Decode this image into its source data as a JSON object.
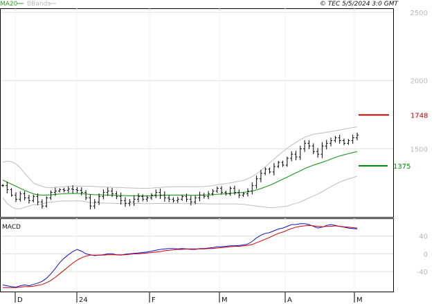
{
  "header": {
    "legend_ma": "MA20",
    "legend_bb": "BBands",
    "copyright": "© TEC 5/5/2024 3:0 GMT"
  },
  "colors": {
    "ma": "#2ca02c",
    "bbands": "#bdbdbd",
    "resistance": "#c00000",
    "support": "#009000",
    "macd": "#1010d0",
    "signal": "#cc0000",
    "bars": "#000000",
    "grid": "#e0e0e0"
  },
  "chart_data": [
    {
      "type": "ohlc",
      "x_axis": {
        "ticks": [
          "D",
          "24",
          "F",
          "M",
          "A",
          "M"
        ]
      },
      "y_axis": {
        "ticks": [
          "2500",
          "2000",
          "1500"
        ],
        "range": [
          1000,
          2530
        ]
      },
      "levels": [
        {
          "label": "1748",
          "value": 1748,
          "color": "#c00000"
        },
        {
          "label": "1375",
          "value": 1375,
          "color": "#009000"
        }
      ],
      "series": {
        "close": [
          1230,
          1200,
          1160,
          1130,
          1170,
          1140,
          1120,
          1150,
          1110,
          1080,
          1140,
          1180,
          1190,
          1200,
          1195,
          1205,
          1200,
          1195,
          1180,
          1140,
          1080,
          1110,
          1150,
          1180,
          1190,
          1170,
          1150,
          1120,
          1100,
          1110,
          1130,
          1150,
          1130,
          1140,
          1160,
          1180,
          1160,
          1140,
          1130,
          1120,
          1130,
          1150,
          1130,
          1110,
          1140,
          1160,
          1150,
          1170,
          1190,
          1210,
          1180,
          1170,
          1210,
          1180,
          1160,
          1170,
          1190,
          1230,
          1280,
          1320,
          1350,
          1330,
          1370,
          1400,
          1380,
          1430,
          1460,
          1440,
          1500,
          1540,
          1520,
          1480,
          1460,
          1520,
          1540,
          1560,
          1580,
          1560,
          1540,
          1560,
          1580,
          1600
        ],
        "ma20": [
          1270,
          1255,
          1240,
          1225,
          1210,
          1195,
          1182,
          1170,
          1162,
          1160,
          1160,
          1162,
          1165,
          1168,
          1170,
          1171,
          1172,
          1172,
          1171,
          1168,
          1165,
          1163,
          1162,
          1161,
          1160,
          1159,
          1158,
          1157,
          1156,
          1155,
          1155,
          1155,
          1154,
          1154,
          1155,
          1157,
          1158,
          1159,
          1160,
          1160,
          1160,
          1160,
          1160,
          1159,
          1159,
          1160,
          1160,
          1161,
          1163,
          1166,
          1168,
          1170,
          1173,
          1176,
          1178,
          1180,
          1184,
          1190,
          1198,
          1208,
          1220,
          1232,
          1246,
          1262,
          1277,
          1292,
          1308,
          1323,
          1338,
          1354,
          1368,
          1380,
          1390,
          1400,
          1412,
          1424,
          1436,
          1447,
          1456,
          1464,
          1472,
          1480
        ],
        "bb_upper": [
          1400,
          1410,
          1405,
          1390,
          1360,
          1320,
          1285,
          1250,
          1235,
          1225,
          1215,
          1215,
          1218,
          1220,
          1222,
          1225,
          1226,
          1226,
          1225,
          1225,
          1225,
          1223,
          1221,
          1220,
          1219,
          1218,
          1217,
          1216,
          1214,
          1213,
          1212,
          1211,
          1210,
          1210,
          1212,
          1215,
          1217,
          1219,
          1220,
          1221,
          1222,
          1222,
          1222,
          1221,
          1221,
          1222,
          1223,
          1226,
          1230,
          1236,
          1240,
          1244,
          1250,
          1256,
          1262,
          1268,
          1280,
          1296,
          1316,
          1340,
          1368,
          1396,
          1424,
          1452,
          1478,
          1504,
          1526,
          1546,
          1566,
          1584,
          1596,
          1606,
          1612,
          1616,
          1620,
          1626,
          1632,
          1638,
          1644,
          1650,
          1656,
          1660
        ],
        "bb_lower": [
          1140,
          1100,
          1075,
          1060,
          1060,
          1070,
          1079,
          1090,
          1089,
          1095,
          1105,
          1109,
          1112,
          1116,
          1118,
          1117,
          1118,
          1118,
          1117,
          1111,
          1105,
          1103,
          1103,
          1102,
          1101,
          1100,
          1099,
          1098,
          1098,
          1097,
          1098,
          1099,
          1098,
          1098,
          1098,
          1099,
          1099,
          1099,
          1100,
          1099,
          1098,
          1098,
          1098,
          1097,
          1097,
          1098,
          1097,
          1096,
          1096,
          1096,
          1096,
          1096,
          1096,
          1096,
          1094,
          1092,
          1088,
          1084,
          1080,
          1076,
          1072,
          1068,
          1068,
          1072,
          1076,
          1080,
          1090,
          1100,
          1110,
          1124,
          1140,
          1154,
          1168,
          1184,
          1204,
          1222,
          1240,
          1256,
          1268,
          1278,
          1288,
          1300
        ]
      }
    },
    {
      "type": "line",
      "panel_label": "MACD",
      "y_axis": {
        "ticks": [
          "40",
          "0",
          "-40"
        ],
        "range": [
          -85,
          80
        ]
      },
      "series": [
        {
          "key": "macd",
          "values": [
            -70,
            -72,
            -74,
            -75,
            -72,
            -70,
            -72,
            -69,
            -66,
            -62,
            -55,
            -45,
            -33,
            -20,
            -10,
            -2,
            5,
            10,
            6,
            0,
            -2,
            -4,
            -3,
            -2,
            0,
            0,
            -2,
            -3,
            -1,
            0,
            1,
            2,
            3,
            4,
            6,
            8,
            10,
            11,
            12,
            12,
            11,
            12,
            11,
            10,
            10,
            12,
            12,
            13,
            14,
            16,
            16,
            17,
            18,
            18,
            19,
            20,
            22,
            28,
            36,
            42,
            46,
            48,
            52,
            56,
            58,
            62,
            66,
            66,
            68,
            68,
            66,
            62,
            58,
            60,
            64,
            66,
            64,
            62,
            60,
            58,
            57,
            56
          ]
        },
        {
          "key": "signal",
          "values": [
            -76,
            -76,
            -76,
            -76,
            -75,
            -74,
            -74,
            -73,
            -71,
            -69,
            -65,
            -60,
            -53,
            -45,
            -37,
            -29,
            -21,
            -14,
            -9,
            -5,
            -3,
            -3,
            -3,
            -3,
            -2,
            -2,
            -2,
            -2,
            -2,
            -1,
            0,
            0,
            1,
            2,
            3,
            4,
            5,
            7,
            8,
            9,
            10,
            10,
            11,
            11,
            11,
            11,
            11,
            12,
            12,
            13,
            14,
            15,
            16,
            17,
            17,
            18,
            19,
            21,
            25,
            29,
            33,
            37,
            42,
            46,
            49,
            53,
            57,
            60,
            62,
            63,
            64,
            63,
            62,
            61,
            62,
            62,
            63,
            62,
            61,
            60,
            59,
            58
          ]
        }
      ]
    }
  ]
}
